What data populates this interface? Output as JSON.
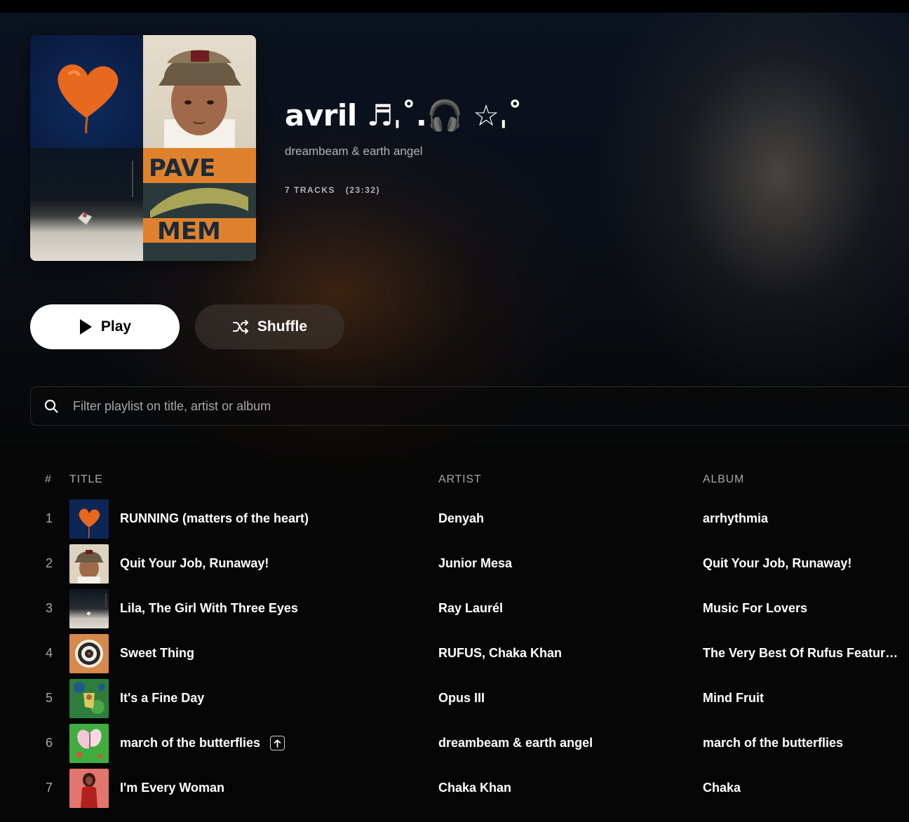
{
  "playlist": {
    "title": "avril ♬ˌ˚.🎧 ☆ˌ˚",
    "owner": "dreambeam & earth angel",
    "track_count": "7 TRACKS",
    "duration": "(23:32)"
  },
  "actions": {
    "play_label": "Play",
    "shuffle_label": "Shuffle"
  },
  "search": {
    "placeholder": "Filter playlist on title, artist or album"
  },
  "table": {
    "headers": {
      "num": "#",
      "title": "TITLE",
      "artist": "ARTIST",
      "album": "ALBUM"
    },
    "rows": [
      {
        "num": "1",
        "title": "RUNNING (matters of the heart)",
        "artist": "Denyah",
        "album": "arrhythmia",
        "art": "heart-balloon"
      },
      {
        "num": "2",
        "title": "Quit Your Job, Runaway!",
        "artist": "Junior Mesa",
        "album": "Quit Your Job, Runaway!",
        "art": "portrait-cap"
      },
      {
        "num": "3",
        "title": "Lila, The Girl With Three Eyes",
        "artist": "Ray Laurél",
        "album": "Music For Lovers",
        "art": "night-road"
      },
      {
        "num": "4",
        "title": "Sweet Thing",
        "artist": "RUFUS, Chaka Khan",
        "album": "The Very Best Of Rufus Featuring Chaka Khan",
        "art": "target"
      },
      {
        "num": "5",
        "title": "It's a Fine Day",
        "artist": "Opus III",
        "album": "Mind Fruit",
        "art": "green-collage"
      },
      {
        "num": "6",
        "title": "march of the butterflies",
        "artist": "dreambeam & earth angel",
        "album": "march of the butterflies",
        "art": "butterfly",
        "uploaded": true
      },
      {
        "num": "7",
        "title": "I'm Every Woman",
        "artist": "Chaka Khan",
        "album": "Chaka",
        "art": "red-woman"
      }
    ]
  },
  "colors": {
    "accent_play_bg": "#ffffff",
    "shuffle_bg": "#3c3430",
    "muted_text": "#a7a7a7"
  }
}
